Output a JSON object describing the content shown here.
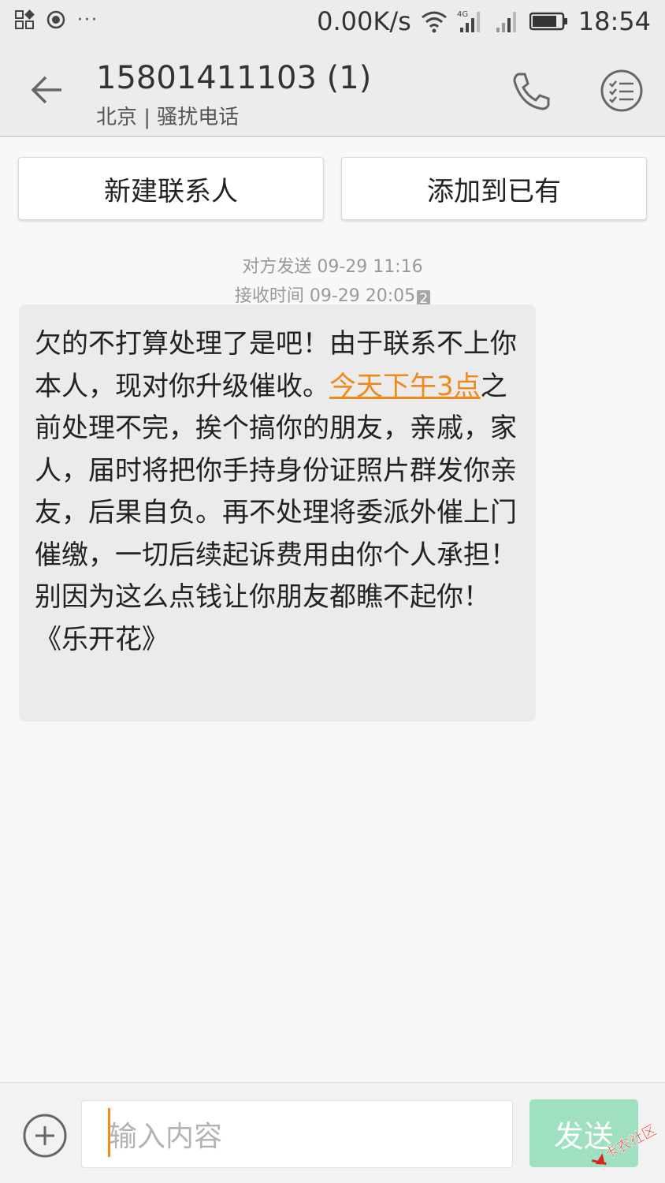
{
  "status_bar": {
    "net_speed": "0.00K/s",
    "network_badge": "4G",
    "time": "18:54",
    "dots": "···",
    "icons": [
      "notification-grid-icon",
      "record-icon",
      "wifi-icon",
      "signal-4g-icon",
      "signal-icon",
      "battery-icon"
    ]
  },
  "header": {
    "title": "15801411103 (1)",
    "subtitle": "北京 | 骚扰电话",
    "icons": [
      "back-arrow-icon",
      "phone-call-icon",
      "menu-list-icon"
    ]
  },
  "contact_actions": {
    "new_contact": "新建联系人",
    "add_existing": "添加到已有"
  },
  "message": {
    "sent_time": "对方发送 09-29 11:16",
    "received_time": "接收时间 09-29 20:05",
    "sim_slot": "2",
    "text_before": "欠的不打算处理了是吧！由于联系不上你本人，现对你升级催收。",
    "link_text": "今天下午3点",
    "text_after": "之前处理不完，挨个搞你的朋友，亲戚，家人，届时将把你手持身份证照片群发你亲友，后果自负。再不处理将委派外催上门催缴，一切后续起诉费用由你个人承担！别因为这么点钱让你朋友都瞧不起你！《乐开花》"
  },
  "composer": {
    "placeholder": "输入内容",
    "send_label": "发送",
    "icons": [
      "add-circle-icon"
    ]
  },
  "watermark": {
    "text": "卡农社区"
  },
  "colors": {
    "link": "#f0891a",
    "send_button": "#9fe0c0",
    "bubble": "#ebebeb",
    "background": "#f8f8f8"
  }
}
